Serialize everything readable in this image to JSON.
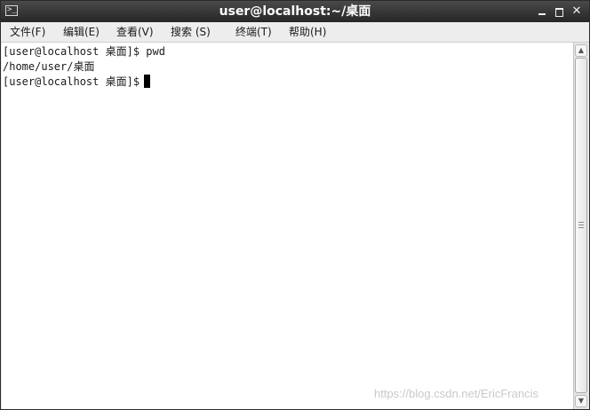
{
  "window": {
    "title": "user@localhost:~/桌面"
  },
  "menubar": {
    "items": [
      {
        "label": "文件(F)"
      },
      {
        "label": "编辑(E)"
      },
      {
        "label": "查看(V)"
      },
      {
        "label": "搜索 (S)"
      },
      {
        "label": "终端(T)"
      },
      {
        "label": "帮助(H)"
      }
    ]
  },
  "terminal": {
    "lines": [
      "[user@localhost 桌面]$ pwd",
      "/home/user/桌面",
      "[user@localhost 桌面]$"
    ]
  },
  "icons": {
    "app": "terminal-icon",
    "minimize": "minimize-icon",
    "maximize": "maximize-icon",
    "close": "close-icon",
    "scroll_up": "arrow-up-icon",
    "scroll_down": "arrow-down-icon"
  },
  "colors": {
    "titlebar": "#333333",
    "menubar": "#ededed",
    "terminal_bg": "#ffffff",
    "terminal_fg": "#1a1a1a"
  },
  "watermark": "https://blog.csdn.net/EricFrancis"
}
